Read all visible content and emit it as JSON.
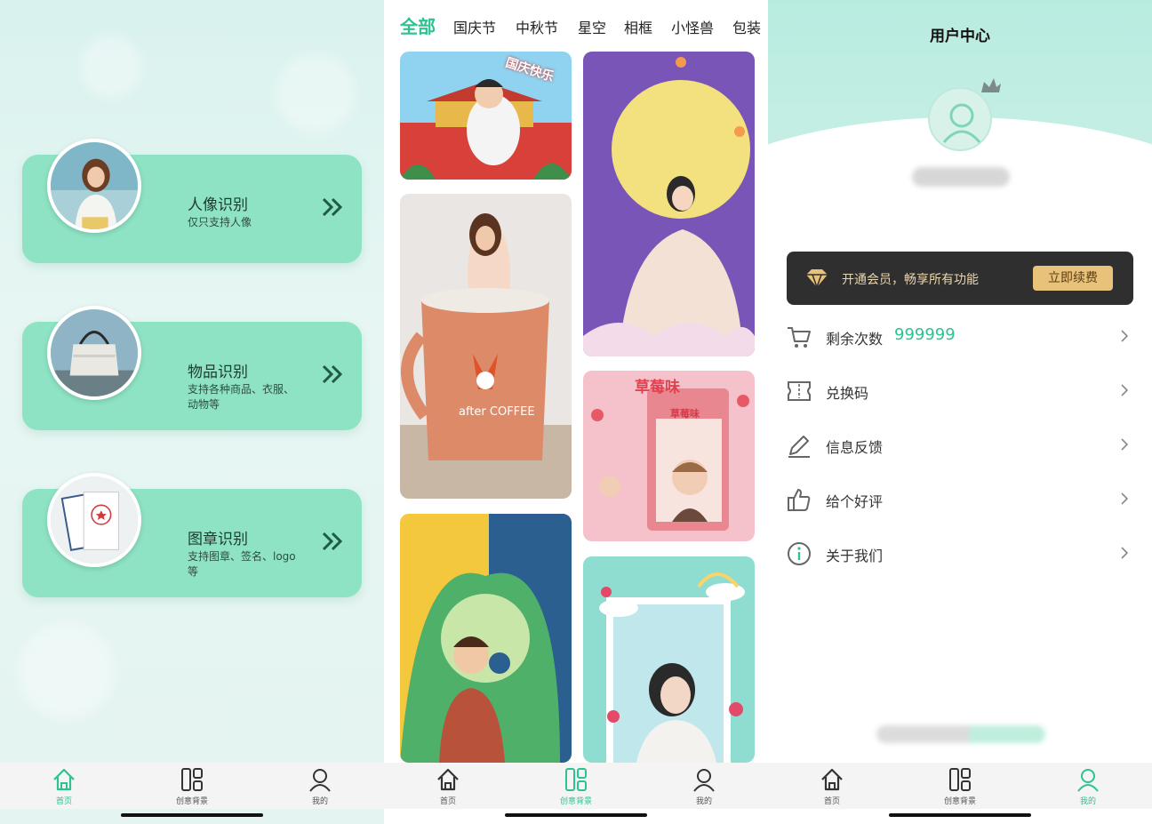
{
  "panel1": {
    "cards": [
      {
        "title": "人像识别",
        "subtitle": "仅只支持人像"
      },
      {
        "title": "物品识别",
        "subtitle": "支持各种商品、衣服、动物等"
      },
      {
        "title": "图章识别",
        "subtitle": "支持图章、签名、logo等"
      }
    ]
  },
  "panel2": {
    "tabs": [
      "全部",
      "国庆节",
      "中秋节",
      "星空",
      "相框",
      "小怪兽",
      "包装"
    ],
    "active_tab": "全部",
    "tile_texts": {
      "guoqing": "国庆快乐",
      "mug": "after COFFEE",
      "strawberry": "草莓味",
      "strawberry_inner": "草莓味"
    }
  },
  "panel3": {
    "title": "用户中心",
    "vip_banner": {
      "text": "开通会员，畅享所有功能",
      "button": "立即续费"
    },
    "menu": [
      {
        "label": "剩余次数",
        "value": "999999",
        "icon": "cart-icon"
      },
      {
        "label": "兑换码",
        "icon": "ticket-icon"
      },
      {
        "label": "信息反馈",
        "icon": "pencil-icon"
      },
      {
        "label": "给个好评",
        "icon": "thumbs-up-icon"
      },
      {
        "label": "关于我们",
        "icon": "info-icon"
      }
    ]
  },
  "nav": {
    "items": [
      {
        "label": "首页",
        "icon": "home-icon"
      },
      {
        "label": "创意背景",
        "icon": "layout-icon"
      },
      {
        "label": "我的",
        "icon": "user-icon"
      }
    ]
  },
  "colors": {
    "accent": "#2ec28f",
    "card": "#8ee3c4",
    "vip_bg": "#2f2f2f",
    "vip_button": "#e8c27a"
  }
}
